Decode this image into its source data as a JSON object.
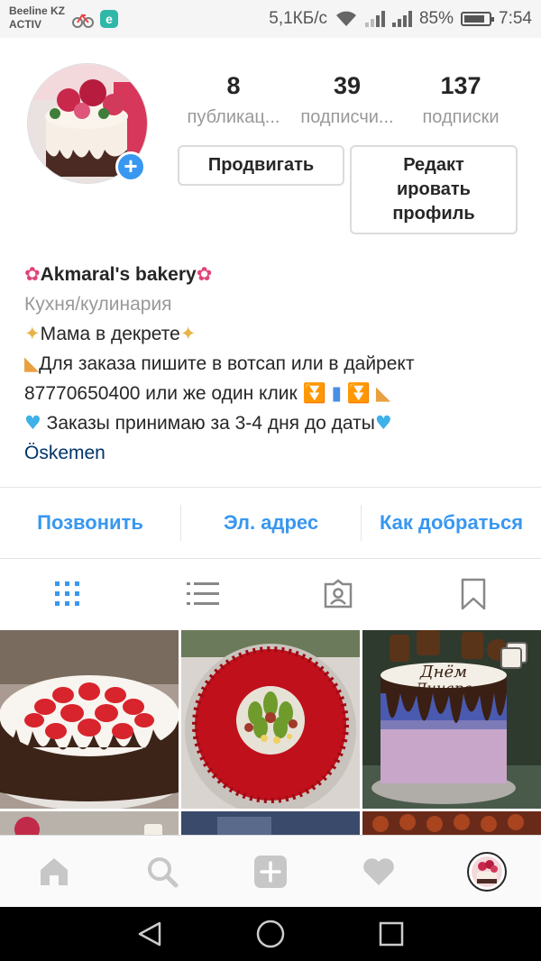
{
  "status_bar": {
    "carrier_line1": "Beeline KZ",
    "carrier_line2": "ACTIV",
    "speed": "5,1КБ/с",
    "battery": "85%",
    "battery_level": 0.85,
    "time": "7:54"
  },
  "profile": {
    "stats": [
      {
        "value": "8",
        "label": "публикац..."
      },
      {
        "value": "39",
        "label": "подписчи..."
      },
      {
        "value": "137",
        "label": "подписки"
      }
    ],
    "promote_label": "Продвигать",
    "edit_label_line1": "Редакт",
    "edit_label_line2": "ировать",
    "edit_label_line3": "профиль"
  },
  "bio": {
    "name": "Akmaral's bakery",
    "category": "Кухня/кулинария",
    "line1": "Мама в декрете",
    "line2": "Для заказа пишите в вотсап или в дайрект",
    "line3": "87770650400 или же один клик",
    "line4": " Заказы принимаю за 3-4 дня до даты",
    "location": "Öskemen"
  },
  "actions": {
    "call": "Позвонить",
    "email": "Эл. адрес",
    "directions": "Как добраться"
  },
  "tabs": [
    "grid-icon",
    "list-icon",
    "tagged-icon",
    "saved-icon"
  ],
  "bottom_nav": [
    "home-icon",
    "search-icon",
    "add-post-icon",
    "heart-icon",
    "profile-avatar-icon"
  ],
  "colors": {
    "accent": "#3897f0",
    "location": "#003569",
    "muted": "#999999"
  }
}
